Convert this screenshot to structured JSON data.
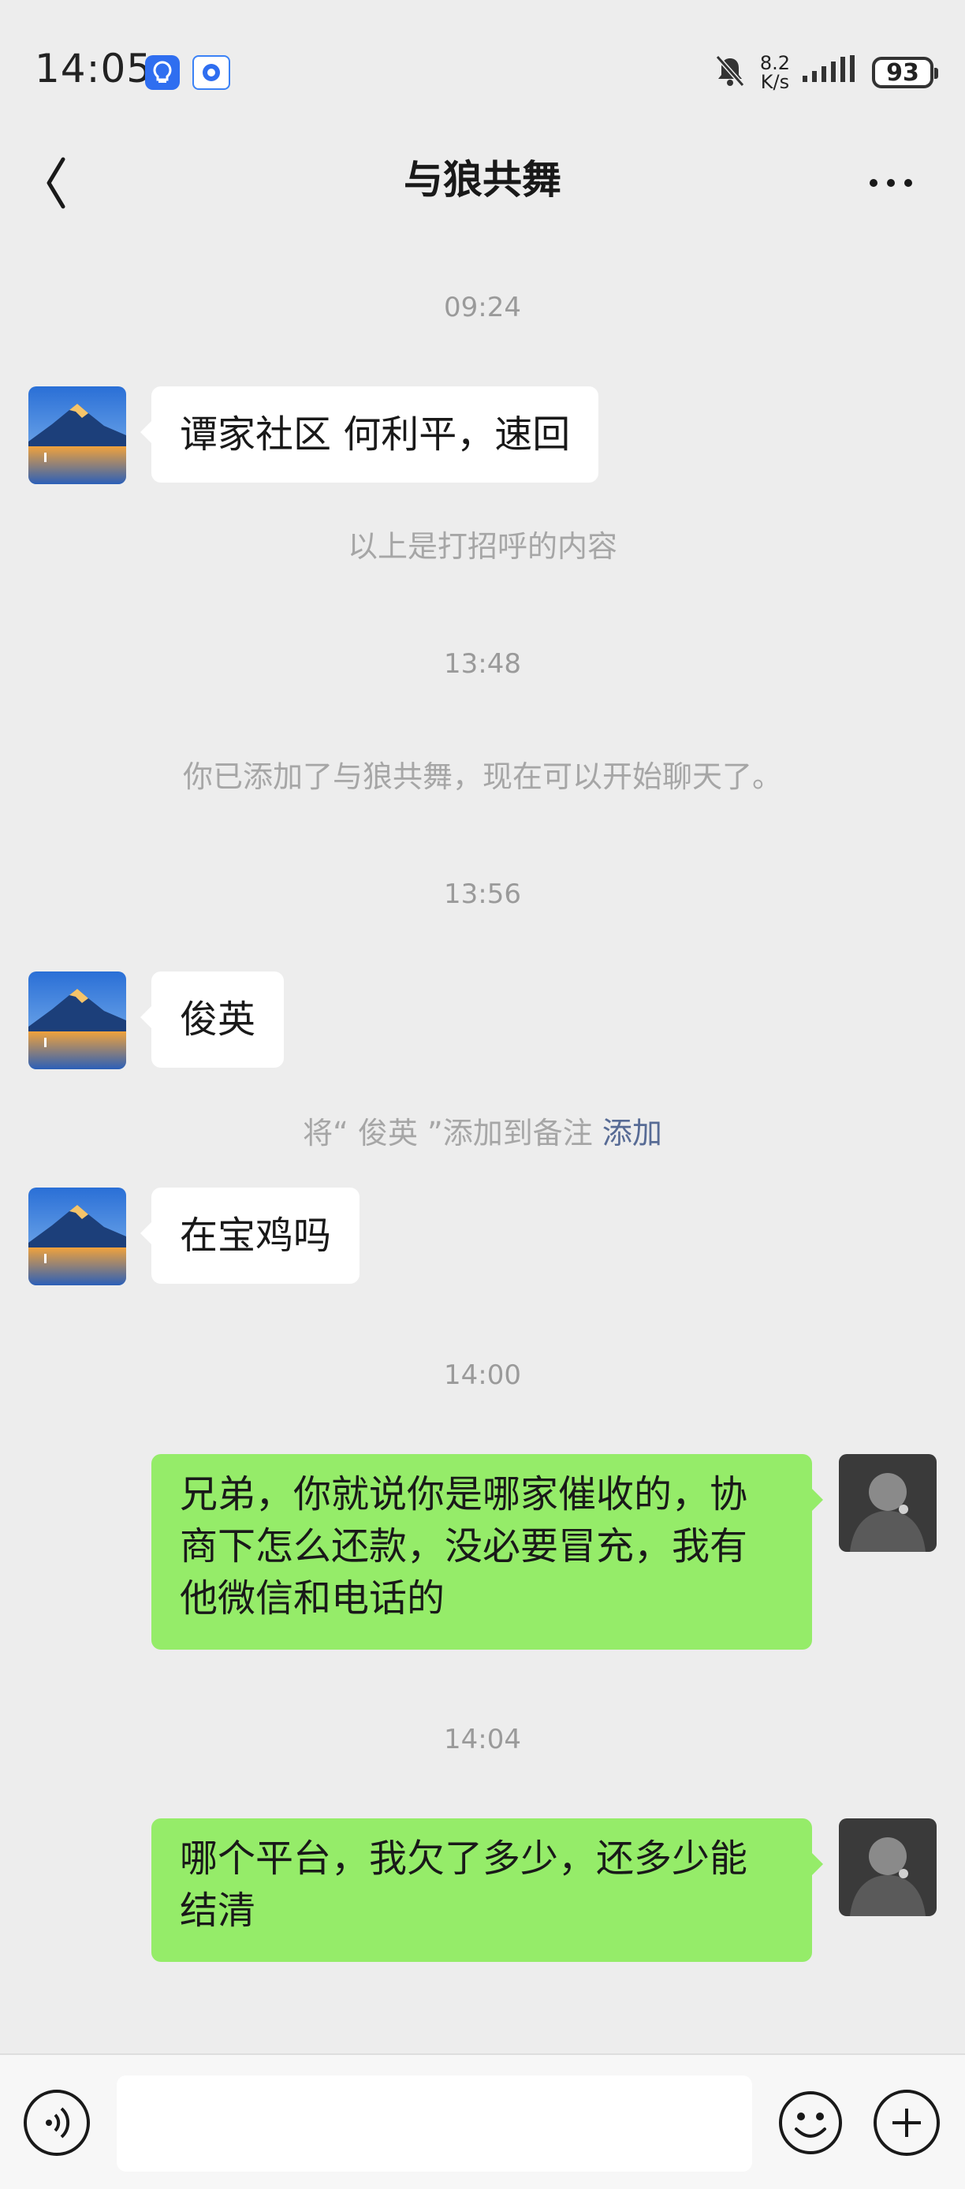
{
  "status_bar": {
    "time": "14:05",
    "net_speed_value": "8.2",
    "net_speed_unit": "K/s",
    "battery": "93",
    "icons": [
      "lightbulb-app-icon",
      "blue-app-icon",
      "mute-bell-icon",
      "signal-icon",
      "battery-icon"
    ]
  },
  "header": {
    "title": "与狼共舞",
    "back_icon": "chevron-left-icon",
    "more_icon": "more-dots-icon"
  },
  "messages": [
    {
      "kind": "time",
      "text": "09:24"
    },
    {
      "kind": "incoming",
      "text": "谭家社区 何利平，速回"
    },
    {
      "kind": "system",
      "text": "以上是打招呼的内容"
    },
    {
      "kind": "time",
      "text": "13:48"
    },
    {
      "kind": "system",
      "text": "你已添加了与狼共舞，现在可以开始聊天了。"
    },
    {
      "kind": "time",
      "text": "13:56"
    },
    {
      "kind": "incoming",
      "text": "俊英"
    },
    {
      "kind": "system",
      "text": "将“ 俊英 ”添加到备注",
      "link": "添加"
    },
    {
      "kind": "incoming",
      "text": "在宝鸡吗"
    },
    {
      "kind": "time",
      "text": "14:00"
    },
    {
      "kind": "outgoing",
      "lines": [
        "兄弟，你就说你是哪家催收的，协",
        "商下怎么还款，没必要冒充，我有",
        "他微信和电话的"
      ]
    },
    {
      "kind": "time",
      "text": "14:04"
    },
    {
      "kind": "outgoing",
      "lines": [
        "哪个平台，我欠了多少，还多少能",
        "结清"
      ]
    }
  ],
  "input_bar": {
    "value": "",
    "icons": [
      "voice-icon",
      "emoji-icon",
      "plus-icon"
    ]
  },
  "colors": {
    "background": "#ededed",
    "outgoing_bubble": "#95ec69",
    "incoming_bubble": "#ffffff",
    "link": "#576b95",
    "timestamp": "#9a9a9a"
  }
}
